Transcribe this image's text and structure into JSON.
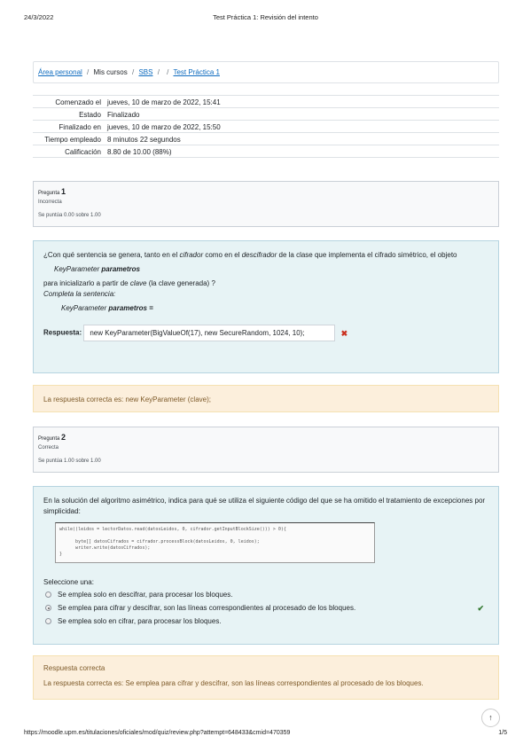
{
  "print_header": {
    "date": "24/3/2022",
    "title": "Test Práctica 1: Revisión del intento"
  },
  "breadcrumb": {
    "items": [
      {
        "label": "Área personal",
        "link": true
      },
      {
        "label": "Mis cursos",
        "link": false
      },
      {
        "label": "SBS",
        "link": true
      },
      {
        "label": "",
        "link": false
      },
      {
        "label": "",
        "link": false
      },
      {
        "label": "Test Práctica 1",
        "link": true
      }
    ],
    "separator": "/"
  },
  "summary": [
    {
      "label": "Comenzado el",
      "value": "jueves, 10 de marzo de 2022, 15:41"
    },
    {
      "label": "Estado",
      "value": "Finalizado"
    },
    {
      "label": "Finalizado en",
      "value": "jueves, 10 de marzo de 2022, 15:50"
    },
    {
      "label": "Tiempo empleado",
      "value": "8 minutos 22 segundos"
    },
    {
      "label": "Calificación",
      "value": "8.80 de 10.00 (88%)"
    }
  ],
  "q1": {
    "info": {
      "prefix": "Pregunta",
      "number": "1",
      "state": "Incorrecta",
      "grade": "Se puntúa 0.00 sobre 1.00"
    },
    "text_part1": "¿Con qué sentencia se genera, tanto en el ",
    "text_cifrador": "cifrador",
    "text_part2": " como en el ",
    "text_descifrador": "descifrador",
    "text_part3": " de la clase que implementa el cifrado simétrico,  el objeto",
    "code_type": "KeyParameter",
    "code_var": "parametros",
    "text_part4": "para inicializarlo a partir de ",
    "text_clave": "clave",
    "text_part5": " (la clave generada) ?",
    "complete": "Completa la sentencia:",
    "code2_type": "KeyParameter",
    "code2_var": "parametros =",
    "answer_label": "Respuesta:",
    "answer_value": "new KeyParameter(BigValueOf(17), new SecureRandom, 1024, 10);",
    "wrong_mark": "✖",
    "feedback": "La respuesta correcta es: new KeyParameter (clave);"
  },
  "q2": {
    "info": {
      "prefix": "Pregunta",
      "number": "2",
      "state": "Correcta",
      "grade": "Se puntúa 1.00 sobre 1.00"
    },
    "text": "En la solución del algoritmo asimétrico, indica para qué se utiliza el siguiente código del que se ha omitido el tratamiento de excepciones por simplicidad:",
    "code_lines": [
      "while((leidos = lectorDatos.read(datosLeidos, 0, cifrador.getInputBlockSize())) > 0){",
      "",
      "      byte[] datosCifrados = cifrador.processBlock(datosLeidos, 0, leidos);",
      "      writer.write(datosCifrados);",
      "}"
    ],
    "select_label": "Seleccione una:",
    "options": [
      {
        "label": "Se emplea solo en descifrar, para procesar los bloques.",
        "checked": false
      },
      {
        "label": "Se emplea para cifrar y descifrar, son las líneas correspondientes al procesado de los bloques.",
        "checked": true
      },
      {
        "label": "Se emplea solo en cifrar, para procesar los bloques.",
        "checked": false
      }
    ],
    "correct_mark": "✔",
    "feedback_title": "Respuesta correcta",
    "feedback": "La respuesta correcta es: Se emplea para cifrar y descifrar, son las líneas correspondientes al procesado de los bloques."
  },
  "scroll_top_icon": "↑",
  "print_footer": {
    "url": "https://moodle.upm.es/titulaciones/oficiales/mod/quiz/review.php?attempt=648433&cmid=470359",
    "page": "1/5"
  }
}
